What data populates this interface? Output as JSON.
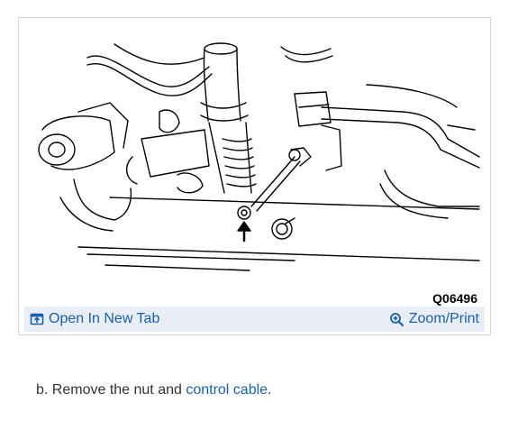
{
  "figure": {
    "code": "Q06496"
  },
  "actions": {
    "open_tab_label": "Open In New Tab",
    "open_tab_icon": "open-in-new-tab-icon",
    "zoom_label": "Zoom/Print",
    "zoom_icon": "magnifier-icon"
  },
  "step": {
    "prefix": "b. Remove the nut and ",
    "link_text": "control cable",
    "suffix": "."
  },
  "colors": {
    "link": "#1a5fa8",
    "action_bar_bg": "#e9eef4",
    "frame_border": "#d6d6d6"
  }
}
